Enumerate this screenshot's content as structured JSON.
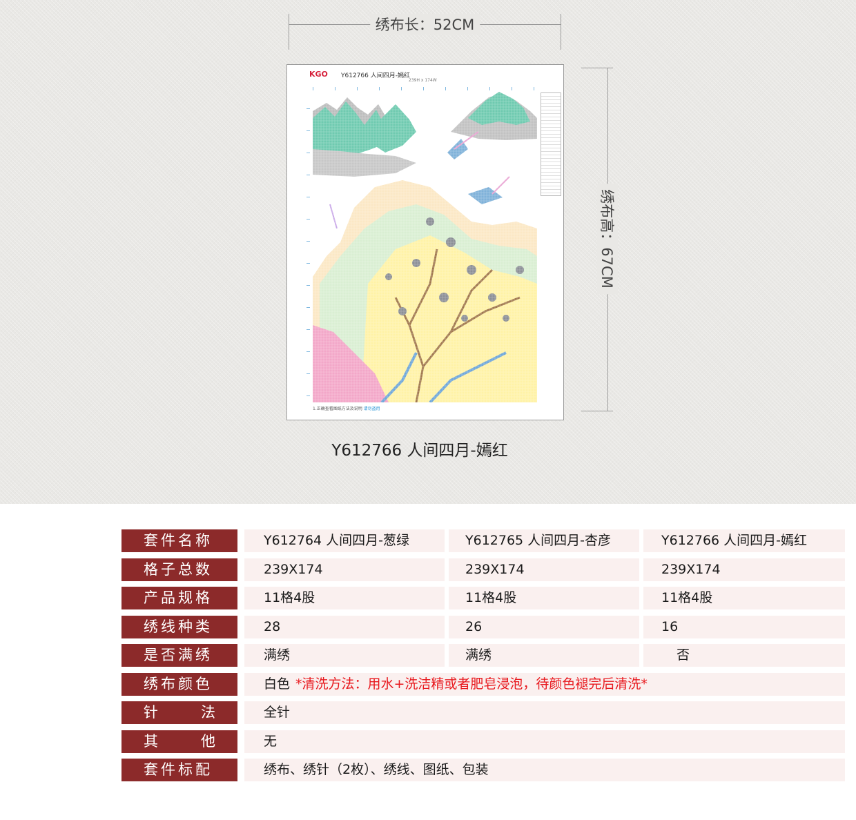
{
  "dimensions": {
    "width_label": "绣布长：52CM",
    "height_label": "绣布高：67CM"
  },
  "pattern_preview": {
    "brand": "KGO",
    "title": "Y612766 人间四月-嫣红",
    "grid_size": "239H x 174W",
    "footer_text": "1.正确查看图纸方法及说明",
    "footer_link": "请勿盗用"
  },
  "caption": "Y612766 人间四月-嫣红",
  "colors": {
    "header_bg": "#8c2a2a",
    "cell_bg": "#faf0ef",
    "note_red": "#e8191e",
    "mountain_green": "#6fcab0"
  },
  "spec_table": {
    "rows": [
      {
        "label": "套件名称",
        "values": [
          "Y612764 人间四月-葱绿",
          "Y612765 人间四月-杏彦",
          "Y612766 人间四月-嫣红"
        ]
      },
      {
        "label": "格子总数",
        "values": [
          "239X174",
          "239X174",
          "239X174"
        ]
      },
      {
        "label": "产品规格",
        "values": [
          "11格4股",
          "11格4股",
          "11格4股"
        ]
      },
      {
        "label": "绣线种类",
        "values": [
          "28",
          "26",
          "16"
        ]
      },
      {
        "label": "是否满绣",
        "values": [
          "满绣",
          "满绣",
          "否"
        ]
      },
      {
        "label": "绣布颜色",
        "value": "白色",
        "note": "*清洗方法：用水+洗洁精或者肥皂浸泡，待颜色褪完后清洗*"
      },
      {
        "label_left": "针",
        "label_right": "法",
        "value": "全针"
      },
      {
        "label_left": "其",
        "label_right": "他",
        "value": "无"
      },
      {
        "label": "套件标配",
        "value": "绣布、绣针（2枚）、绣线、图纸、包装"
      }
    ]
  }
}
